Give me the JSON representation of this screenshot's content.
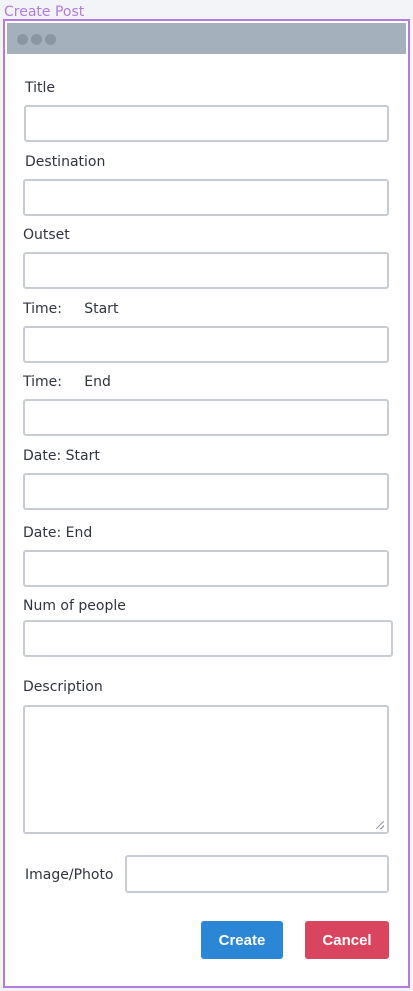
{
  "frame": {
    "title": "Create Post"
  },
  "form": {
    "title_label": "Title",
    "destination_label": "Destination",
    "outset_label": "Outset",
    "time_start_label": "Time:     Start",
    "time_end_label": "Time:     End",
    "date_start_label": "Date: Start",
    "date_end_label": "Date: End",
    "num_people_label": "Num of people",
    "description_label": "Description",
    "image_label": "Image/Photo"
  },
  "buttons": {
    "create": "Create",
    "cancel": "Cancel"
  },
  "colors": {
    "frame_border": "#b47be0",
    "titlebar": "#a4b1bc",
    "create_button": "#2b87d6",
    "cancel_button": "#d9455e"
  }
}
